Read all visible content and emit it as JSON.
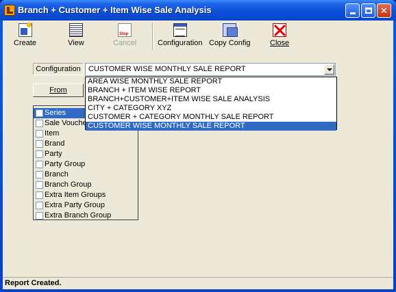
{
  "window": {
    "title": "Branch + Customer + Item Wise Sale Analysis"
  },
  "toolbar": {
    "create": "Create",
    "view": "View",
    "cancel": "Cancel",
    "configuration": "Configuration",
    "copy_config": "Copy Config",
    "close": "Close"
  },
  "config": {
    "label": "Configuration",
    "selected": "CUSTOMER WISE MONTHLY SALE REPORT",
    "options": [
      "AREA WISE MONTHLY SALE REPORT",
      "BRANCH + ITEM WISE REPORT",
      "BRANCH+CUSTOMER+ITEM WISE SALE ANALYSIS",
      "CITY + CATEGORY XYZ",
      "CUSTOMER + CATEGORY MONTHLY SALE REPORT",
      "CUSTOMER WISE MONTHLY SALE REPORT"
    ]
  },
  "from_button": "From",
  "fields": [
    "Series",
    "Sale Voucher",
    "Item",
    "Brand",
    "Party",
    "Party Group",
    "Branch",
    "Branch Group",
    "Extra Item Groups",
    "Extra Party Group",
    "Extra Branch Group"
  ],
  "status": "Report Created."
}
